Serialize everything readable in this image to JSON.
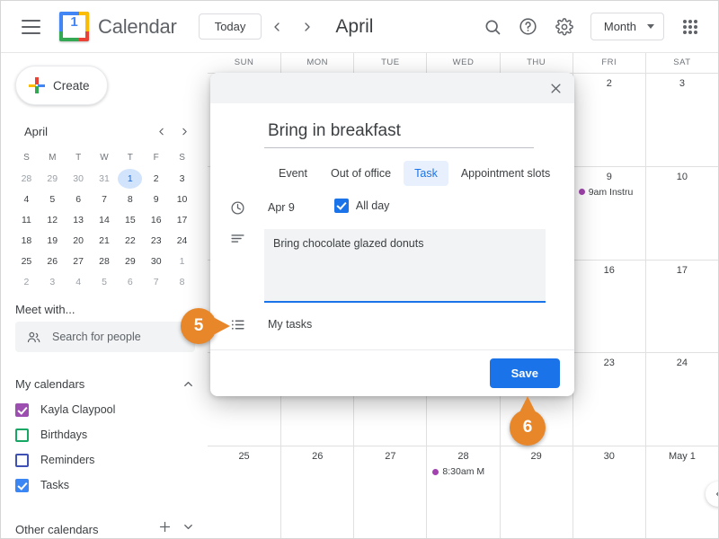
{
  "header": {
    "menu_icon": "hamburger-icon",
    "logo_icon": "google-calendar-icon",
    "logo_day": "1",
    "brand": "Calendar",
    "today_label": "Today",
    "prev_label": "‹",
    "next_label": "›",
    "month_title": "April",
    "search_icon": "search-icon",
    "help_icon": "help-icon",
    "settings_icon": "gear-icon",
    "view_label": "Month",
    "apps_icon": "apps-grid-icon"
  },
  "sidebar": {
    "create_label": "Create",
    "mini_calendar": {
      "month": "April",
      "prev": "‹",
      "next": "›",
      "dow": [
        "S",
        "M",
        "T",
        "W",
        "T",
        "F",
        "S"
      ],
      "weeks": [
        [
          {
            "d": "28",
            "muted": true
          },
          {
            "d": "29",
            "muted": true
          },
          {
            "d": "30",
            "muted": true
          },
          {
            "d": "31",
            "muted": true
          },
          {
            "d": "1",
            "sel": true
          },
          {
            "d": "2"
          },
          {
            "d": "3"
          }
        ],
        [
          {
            "d": "4"
          },
          {
            "d": "5"
          },
          {
            "d": "6"
          },
          {
            "d": "7"
          },
          {
            "d": "8"
          },
          {
            "d": "9"
          },
          {
            "d": "10"
          }
        ],
        [
          {
            "d": "11"
          },
          {
            "d": "12"
          },
          {
            "d": "13"
          },
          {
            "d": "14"
          },
          {
            "d": "15"
          },
          {
            "d": "16"
          },
          {
            "d": "17"
          }
        ],
        [
          {
            "d": "18"
          },
          {
            "d": "19"
          },
          {
            "d": "20"
          },
          {
            "d": "21"
          },
          {
            "d": "22"
          },
          {
            "d": "23"
          },
          {
            "d": "24"
          }
        ],
        [
          {
            "d": "25"
          },
          {
            "d": "26"
          },
          {
            "d": "27"
          },
          {
            "d": "28"
          },
          {
            "d": "29"
          },
          {
            "d": "30"
          },
          {
            "d": "1",
            "muted": true
          }
        ],
        [
          {
            "d": "2",
            "muted": true
          },
          {
            "d": "3",
            "muted": true
          },
          {
            "d": "4",
            "muted": true
          },
          {
            "d": "5",
            "muted": true
          },
          {
            "d": "6",
            "muted": true
          },
          {
            "d": "7",
            "muted": true
          },
          {
            "d": "8",
            "muted": true
          }
        ]
      ]
    },
    "meet_with_title": "Meet with...",
    "meet_with_placeholder": "Search for people",
    "meet_with_icon": "people-icon",
    "my_calendars": {
      "title": "My calendars",
      "collapse_icon": "chevron-up-icon",
      "items": [
        {
          "label": "Kayla Claypool",
          "checked": true,
          "color": "#9c4fb0"
        },
        {
          "label": "Birthdays",
          "checked": false,
          "color": "#16a765"
        },
        {
          "label": "Reminders",
          "checked": false,
          "color": "#3f51b5"
        },
        {
          "label": "Tasks",
          "checked": true,
          "color": "#3a86f4"
        }
      ]
    },
    "other_calendars": {
      "title": "Other calendars",
      "add_icon": "plus-icon",
      "expand_icon": "chevron-down-icon"
    }
  },
  "grid": {
    "dow": [
      "SUN",
      "MON",
      "TUE",
      "WED",
      "THU",
      "FRI",
      "SAT"
    ],
    "weeks": [
      [
        {
          "day": "",
          "events": []
        },
        {
          "day": "",
          "events": []
        },
        {
          "day": "",
          "events": []
        },
        {
          "day": "",
          "events": []
        },
        {
          "day": "",
          "events": []
        },
        {
          "day": "2",
          "events": []
        },
        {
          "day": "3",
          "events": []
        }
      ],
      [
        {
          "day": "",
          "events": []
        },
        {
          "day": "",
          "events": []
        },
        {
          "day": "",
          "events": []
        },
        {
          "day": "",
          "events": []
        },
        {
          "day": "",
          "events": []
        },
        {
          "day": "9",
          "events": [
            {
              "text": "9am Instru",
              "color": "#a142af"
            }
          ]
        },
        {
          "day": "10",
          "events": []
        }
      ],
      [
        {
          "day": "",
          "events": []
        },
        {
          "day": "",
          "events": []
        },
        {
          "day": "",
          "events": []
        },
        {
          "day": "",
          "events": []
        },
        {
          "day": "",
          "events": []
        },
        {
          "day": "16",
          "events": []
        },
        {
          "day": "17",
          "events": []
        }
      ],
      [
        {
          "day": "",
          "events": []
        },
        {
          "day": "",
          "events": []
        },
        {
          "day": "",
          "events": []
        },
        {
          "day": "",
          "events": []
        },
        {
          "day": "",
          "events": []
        },
        {
          "day": "23",
          "events": []
        },
        {
          "day": "24",
          "events": []
        }
      ],
      [
        {
          "day": "25",
          "events": []
        },
        {
          "day": "26",
          "events": []
        },
        {
          "day": "27",
          "events": []
        },
        {
          "day": "28",
          "events": [
            {
              "text": "8:30am M",
              "color": "#a142af"
            }
          ]
        },
        {
          "day": "29",
          "events": []
        },
        {
          "day": "30",
          "events": []
        },
        {
          "day": "May 1",
          "events": []
        }
      ]
    ],
    "scroll_fab_icon": "chevron-left-icon"
  },
  "dialog": {
    "close_icon": "close-icon",
    "title_value": "Bring in breakfast",
    "tabs": [
      {
        "label": "Event",
        "active": false
      },
      {
        "label": "Out of office",
        "active": false
      },
      {
        "label": "Task",
        "active": true
      },
      {
        "label": "Appointment slots",
        "active": false
      }
    ],
    "clock_icon": "clock-icon",
    "date_value": "Apr 9",
    "allday_label": "All day",
    "allday_checked": true,
    "description_icon": "description-lines-icon",
    "description_value": "Bring chocolate glazed donuts",
    "tasklist_icon": "task-list-icon",
    "tasklist_value": "My tasks",
    "save_label": "Save"
  },
  "callouts": [
    {
      "number": "5"
    },
    {
      "number": "6"
    }
  ]
}
